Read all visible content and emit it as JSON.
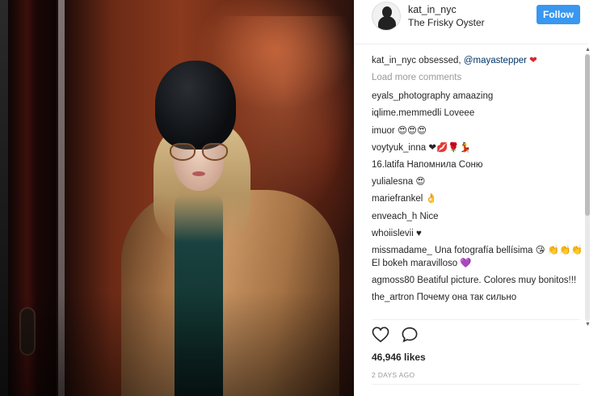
{
  "post": {
    "username": "kat_in_nyc",
    "location": "The Frisky Oyster",
    "follow_label": "Follow",
    "caption": {
      "user": "kat_in_nyc",
      "text": " obsessed, ",
      "mention": "@mayastepper",
      "emoji": "❤"
    },
    "load_more_label": "Load more comments",
    "comments": [
      {
        "user": "eyals_photography",
        "text": "amaazing"
      },
      {
        "user": "iqlime.memmedli",
        "text": "Loveee"
      },
      {
        "user": "imuor",
        "text": "😍😍😍"
      },
      {
        "user": "voytyuk_inna",
        "text": "❤💋🌹💃"
      },
      {
        "user": "16.latifa",
        "text": "Напомнила Соню"
      },
      {
        "user": "yulialesna",
        "text": "😍"
      },
      {
        "user": "mariefrankel",
        "text": "👌"
      },
      {
        "user": "enveach_h",
        "text": "Nice"
      },
      {
        "user": "whoiislevii",
        "text": "♥"
      },
      {
        "user": "missmadame_",
        "text": "Una fotografía bellísima 😘 👏👏👏 El bokeh maravilloso 💜"
      },
      {
        "user": "agmoss80",
        "text": "Beatiful picture. Colores muy bonitos!!!"
      },
      {
        "user": "the_artron",
        "text": "Почему она так сильно"
      }
    ],
    "likes": "46,946 likes",
    "timestamp": "2 DAYS AGO"
  },
  "icons": {
    "like": "heart-outline-icon",
    "comment": "comment-bubble-icon"
  },
  "colors": {
    "follow_button": "#3897f0",
    "mention": "#003569",
    "heart": "#e0212e",
    "muted_text": "#999999"
  }
}
